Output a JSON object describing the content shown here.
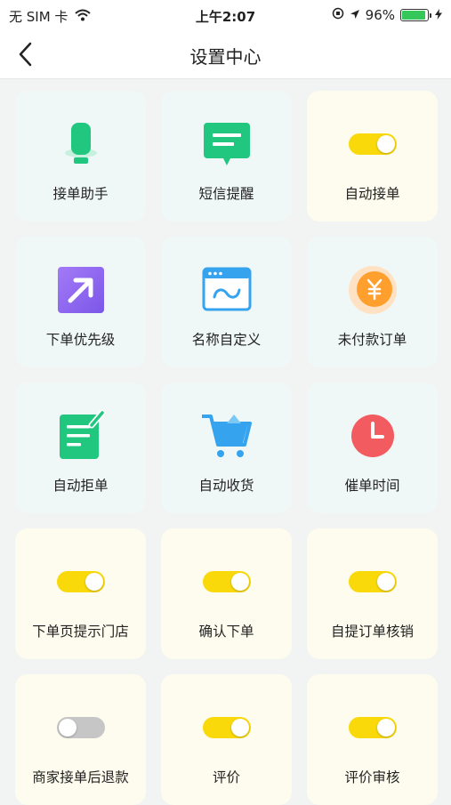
{
  "status_bar": {
    "carrier": "无 SIM 卡",
    "time": "上午2:07",
    "battery": "96%"
  },
  "nav": {
    "title": "设置中心"
  },
  "colors": {
    "toggle_on": "#fad90a",
    "toggle_off": "#c6c6c6",
    "green": "#22c77f"
  },
  "cards": [
    {
      "label": "接单助手",
      "icon": "microphone-icon"
    },
    {
      "label": "短信提醒",
      "icon": "message-icon"
    },
    {
      "label": "自动接单",
      "toggle": "on"
    },
    {
      "label": "下单优先级",
      "icon": "priority-arrow-icon"
    },
    {
      "label": "名称自定义",
      "icon": "custom-name-icon"
    },
    {
      "label": "未付款订单",
      "icon": "yuan-coin-icon"
    },
    {
      "label": "自动拒单",
      "icon": "reject-document-icon"
    },
    {
      "label": "自动收货",
      "icon": "shopping-cart-icon"
    },
    {
      "label": "催单时间",
      "icon": "clock-icon"
    },
    {
      "label": "下单页提示门店",
      "toggle": "on"
    },
    {
      "label": "确认下单",
      "toggle": "on"
    },
    {
      "label": "自提订单核销",
      "toggle": "on"
    },
    {
      "label": "商家接单后退款",
      "toggle": "off"
    },
    {
      "label": "评价",
      "toggle": "on"
    },
    {
      "label": "评价审核",
      "toggle": "on"
    }
  ]
}
